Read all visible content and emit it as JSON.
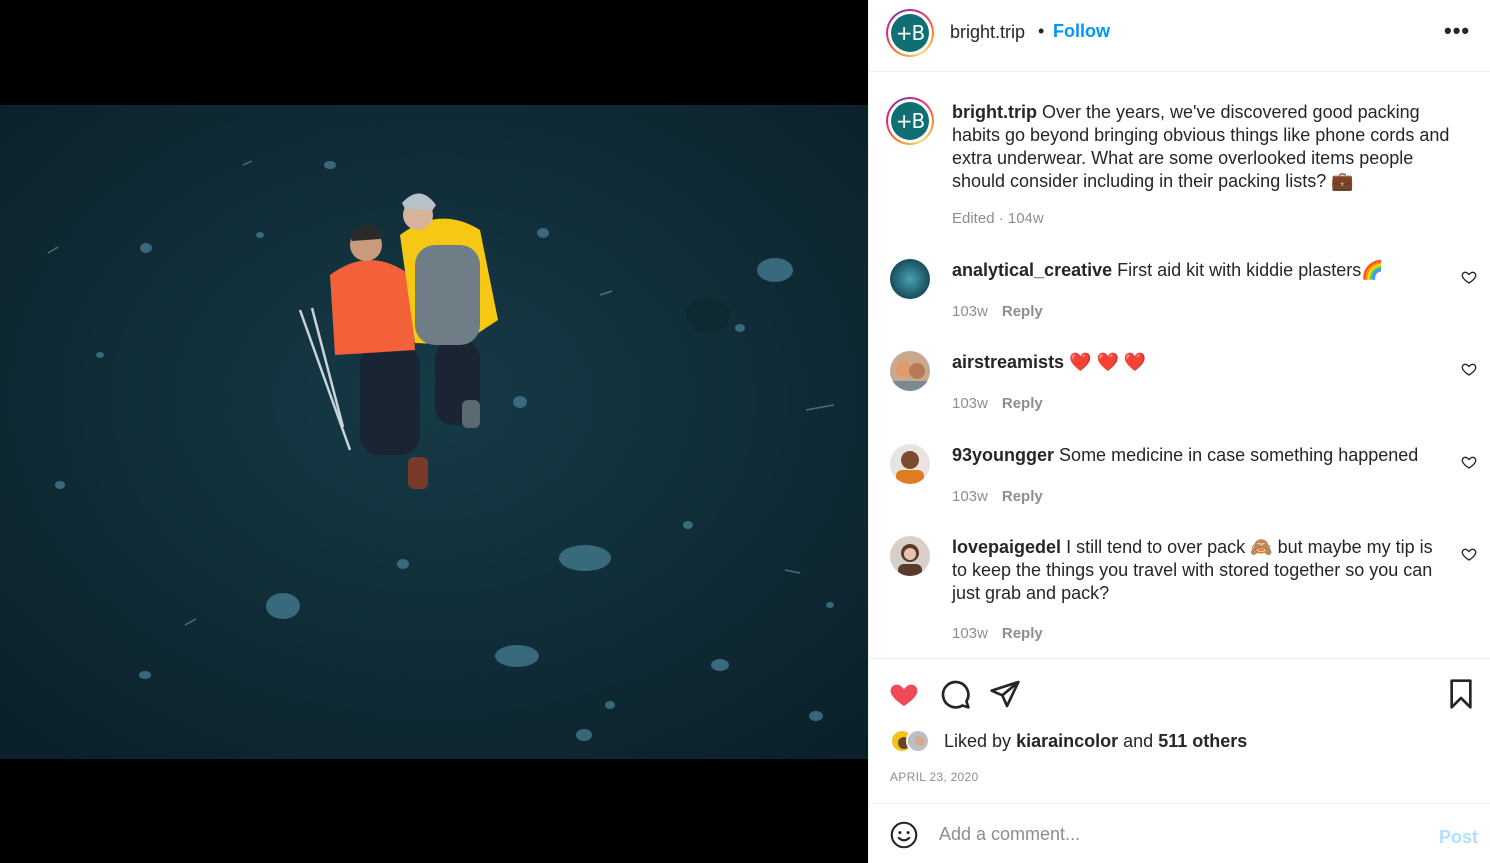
{
  "post": {
    "account": {
      "username": "bright.trip",
      "follow_label": "Follow",
      "avatar_glyph": "+B",
      "more_icon": "more-options-icon"
    },
    "caption": {
      "username": "bright.trip",
      "text": "Over the years, we've discovered good packing habits go beyond bringing obvious things like phone cords and extra underwear. What are some overlooked items people should consider including in their packing lists? 💼",
      "meta": "Edited · 104w"
    },
    "comments": [
      {
        "username": "analytical_creative",
        "text": "First aid kit with kiddie plasters🌈",
        "age": "103w",
        "reply_label": "Reply"
      },
      {
        "username": "airstreamists",
        "text": "❤️ ❤️ ❤️",
        "age": "103w",
        "reply_label": "Reply"
      },
      {
        "username": "93youngger",
        "text": "Some medicine in case something happened",
        "age": "103w",
        "reply_label": "Reply"
      },
      {
        "username": "lovepaigedel",
        "text": "I still tend to over pack 🙈 but maybe my tip is to keep the things you travel with stored together so you can just grab and pack?",
        "age": "103w",
        "reply_label": "Reply"
      }
    ],
    "likes": {
      "prefix": "Liked by",
      "user": "kiaraincolor",
      "joiner": "and",
      "others": "511 others"
    },
    "date": "APRIL 23, 2020",
    "add_comment": {
      "placeholder": "Add a comment...",
      "post_label": "Post"
    },
    "colors": {
      "accent": "#0095f6",
      "like_red": "#ed4956",
      "brand_teal": "#0f6f73",
      "post_disabled": "#b2dffc"
    }
  }
}
